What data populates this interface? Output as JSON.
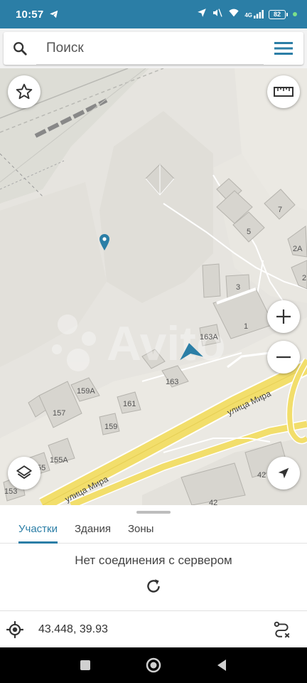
{
  "status": {
    "time": "10:57",
    "network_label": "4G",
    "battery": "82"
  },
  "search": {
    "placeholder": "Поиск",
    "value": ""
  },
  "map": {
    "labels": {
      "b7": "7",
      "b5": "5",
      "b2a": "2А",
      "b3": "3",
      "b2": "2",
      "b1": "1",
      "b163a": "163А",
      "b159a": "159А",
      "b163": "163",
      "b161": "161",
      "b157": "157",
      "b159": "159",
      "b155a": "155А",
      "b155": "55",
      "b153": "153",
      "b42a": "42",
      "b42b": "42",
      "street1": "улица Мира",
      "street2": "улица Мира"
    },
    "watermark": "Avito"
  },
  "sheet": {
    "tabs": [
      {
        "label": "Участки",
        "active": true
      },
      {
        "label": "Здания",
        "active": false
      },
      {
        "label": "Зоны",
        "active": false
      }
    ],
    "message": "Нет соединения с сервером",
    "coordinates": "43.448, 39.93"
  },
  "colors": {
    "accent": "#2b7ea6",
    "road": "#f2de6b",
    "map_bg": "#e6e4df"
  },
  "icons": [
    "telegram-icon",
    "location-arrow-icon",
    "mute-icon",
    "wifi-icon",
    "signal-icon",
    "search-icon",
    "menu-icon",
    "star-icon",
    "ruler-icon",
    "map-pin-icon",
    "zoom-in-icon",
    "zoom-out-icon",
    "layers-icon",
    "compass-arrow-icon",
    "refresh-icon",
    "my-location-icon",
    "route-icon",
    "nav-square-icon",
    "nav-circle-icon",
    "nav-back-icon"
  ]
}
